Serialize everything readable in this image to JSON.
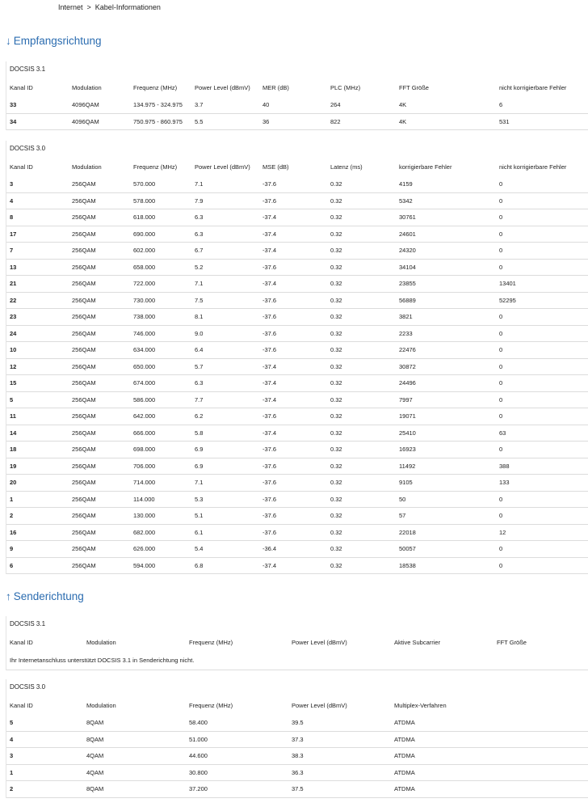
{
  "breadcrumb": {
    "items": [
      "Internet",
      "Kabel-Informationen"
    ],
    "separator": ">"
  },
  "downstream": {
    "arrow": "↓",
    "title": "Empfangsrichtung",
    "docsis31": {
      "title": "DOCSIS 3.1",
      "headers": [
        "Kanal ID",
        "Modulation",
        "Frequenz (MHz)",
        "Power Level (dBmV)",
        "MER (dB)",
        "PLC (MHz)",
        "FFT Größe",
        "nicht korrigierbare Fehler"
      ],
      "rows": [
        [
          "33",
          "4096QAM",
          "134.975 - 324.975",
          "3.7",
          "40",
          "264",
          "4K",
          "6"
        ],
        [
          "34",
          "4096QAM",
          "750.975 - 860.975",
          "5.5",
          "36",
          "822",
          "4K",
          "531"
        ]
      ]
    },
    "docsis30": {
      "title": "DOCSIS 3.0",
      "headers": [
        "Kanal ID",
        "Modulation",
        "Frequenz (MHz)",
        "Power Level (dBmV)",
        "MSE (dB)",
        "Latenz (ms)",
        "korrigierbare Fehler",
        "nicht korrigierbare Fehler"
      ],
      "rows": [
        [
          "3",
          "256QAM",
          "570.000",
          "7.1",
          "-37.6",
          "0.32",
          "4159",
          "0"
        ],
        [
          "4",
          "256QAM",
          "578.000",
          "7.9",
          "-37.6",
          "0.32",
          "5342",
          "0"
        ],
        [
          "8",
          "256QAM",
          "618.000",
          "6.3",
          "-37.4",
          "0.32",
          "30761",
          "0"
        ],
        [
          "17",
          "256QAM",
          "690.000",
          "6.3",
          "-37.4",
          "0.32",
          "24601",
          "0"
        ],
        [
          "7",
          "256QAM",
          "602.000",
          "6.7",
          "-37.4",
          "0.32",
          "24320",
          "0"
        ],
        [
          "13",
          "256QAM",
          "658.000",
          "5.2",
          "-37.6",
          "0.32",
          "34104",
          "0"
        ],
        [
          "21",
          "256QAM",
          "722.000",
          "7.1",
          "-37.4",
          "0.32",
          "23855",
          "13401"
        ],
        [
          "22",
          "256QAM",
          "730.000",
          "7.5",
          "-37.6",
          "0.32",
          "56889",
          "52295"
        ],
        [
          "23",
          "256QAM",
          "738.000",
          "8.1",
          "-37.6",
          "0.32",
          "3821",
          "0"
        ],
        [
          "24",
          "256QAM",
          "746.000",
          "9.0",
          "-37.6",
          "0.32",
          "2233",
          "0"
        ],
        [
          "10",
          "256QAM",
          "634.000",
          "6.4",
          "-37.6",
          "0.32",
          "22476",
          "0"
        ],
        [
          "12",
          "256QAM",
          "650.000",
          "5.7",
          "-37.4",
          "0.32",
          "30872",
          "0"
        ],
        [
          "15",
          "256QAM",
          "674.000",
          "6.3",
          "-37.4",
          "0.32",
          "24496",
          "0"
        ],
        [
          "5",
          "256QAM",
          "586.000",
          "7.7",
          "-37.4",
          "0.32",
          "7997",
          "0"
        ],
        [
          "11",
          "256QAM",
          "642.000",
          "6.2",
          "-37.6",
          "0.32",
          "19071",
          "0"
        ],
        [
          "14",
          "256QAM",
          "666.000",
          "5.8",
          "-37.4",
          "0.32",
          "25410",
          "63"
        ],
        [
          "18",
          "256QAM",
          "698.000",
          "6.9",
          "-37.6",
          "0.32",
          "16923",
          "0"
        ],
        [
          "19",
          "256QAM",
          "706.000",
          "6.9",
          "-37.6",
          "0.32",
          "11492",
          "388"
        ],
        [
          "20",
          "256QAM",
          "714.000",
          "7.1",
          "-37.6",
          "0.32",
          "9105",
          "133"
        ],
        [
          "1",
          "256QAM",
          "114.000",
          "5.3",
          "-37.6",
          "0.32",
          "50",
          "0"
        ],
        [
          "2",
          "256QAM",
          "130.000",
          "5.1",
          "-37.6",
          "0.32",
          "57",
          "0"
        ],
        [
          "16",
          "256QAM",
          "682.000",
          "6.1",
          "-37.6",
          "0.32",
          "22018",
          "12"
        ],
        [
          "9",
          "256QAM",
          "626.000",
          "5.4",
          "-36.4",
          "0.32",
          "50057",
          "0"
        ],
        [
          "6",
          "256QAM",
          "594.000",
          "6.8",
          "-37.4",
          "0.32",
          "18538",
          "0"
        ]
      ]
    }
  },
  "upstream": {
    "arrow": "↑",
    "title": "Senderichtung",
    "docsis31": {
      "title": "DOCSIS 3.1",
      "headers": [
        "Kanal ID",
        "Modulation",
        "Frequenz (MHz)",
        "Power Level (dBmV)",
        "Aktive Subcarrier",
        "FFT Größe"
      ],
      "note": "Ihr Internetanschluss unterstützt DOCSIS 3.1 in Senderichtung nicht."
    },
    "docsis30": {
      "title": "DOCSIS 3.0",
      "headers": [
        "Kanal ID",
        "Modulation",
        "Frequenz (MHz)",
        "Power Level (dBmV)",
        "Multiplex-Verfahren"
      ],
      "rows": [
        [
          "5",
          "8QAM",
          "58.400",
          "39.5",
          "ATDMA"
        ],
        [
          "4",
          "8QAM",
          "51.000",
          "37.3",
          "ATDMA"
        ],
        [
          "3",
          "4QAM",
          "44.600",
          "38.3",
          "ATDMA"
        ],
        [
          "1",
          "4QAM",
          "30.800",
          "36.3",
          "ATDMA"
        ],
        [
          "2",
          "8QAM",
          "37.200",
          "37.5",
          "ATDMA"
        ]
      ]
    }
  },
  "colors": {
    "accent": "#2b6cb0",
    "divider": "#dcdcdc",
    "text": "#222222"
  }
}
